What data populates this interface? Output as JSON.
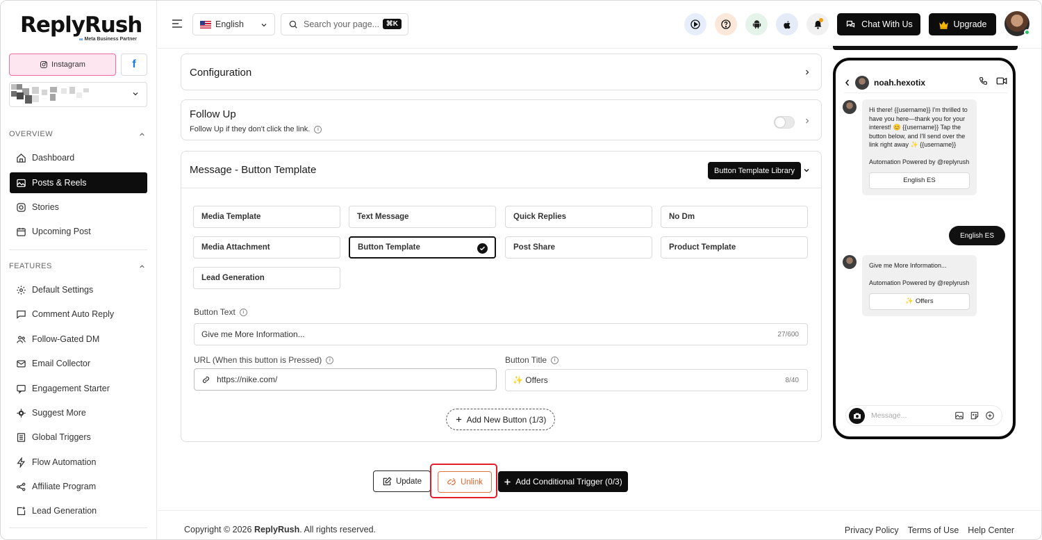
{
  "brand": {
    "name": "ReplyRush",
    "partner": "Meta Business Partner"
  },
  "accounts": {
    "instagram_label": "Instagram",
    "facebook_label": "f"
  },
  "sidebar": {
    "overview_label": "OVERVIEW",
    "features_label": "FEATURES",
    "overview_items": [
      {
        "label": "Dashboard",
        "icon": "home-icon"
      },
      {
        "label": "Posts & Reels",
        "icon": "image-icon",
        "active": true
      },
      {
        "label": "Stories",
        "icon": "instagram-icon"
      },
      {
        "label": "Upcoming Post",
        "icon": "calendar-icon"
      }
    ],
    "feature_items": [
      {
        "label": "Default Settings",
        "icon": "gear-icon"
      },
      {
        "label": "Comment Auto Reply",
        "icon": "comment-icon"
      },
      {
        "label": "Follow-Gated DM",
        "icon": "users-icon"
      },
      {
        "label": "Email Collector",
        "icon": "mail-icon"
      },
      {
        "label": "Engagement Starter",
        "icon": "chat-icon"
      },
      {
        "label": "Suggest More",
        "icon": "sparkle-gear-icon"
      },
      {
        "label": "Global Triggers",
        "icon": "list-icon"
      },
      {
        "label": "Flow Automation",
        "icon": "bolt-icon"
      },
      {
        "label": "Affiliate Program",
        "icon": "share-icon"
      },
      {
        "label": "Lead Generation",
        "icon": "plus-square-icon"
      }
    ]
  },
  "header": {
    "language": "English",
    "search_placeholder": "Search your page...",
    "shortcut": "⌘K",
    "chat_label": "Chat With Us",
    "upgrade_label": "Upgrade"
  },
  "main": {
    "configuration_title": "Configuration",
    "follow_up": {
      "title": "Follow Up",
      "subtitle": "Follow Up if they don't click the link."
    },
    "message_section": {
      "title": "Message - Button Template",
      "library_button": "Button Template Library",
      "options": [
        "Media Template",
        "Text Message",
        "Quick Replies",
        "No Dm",
        "Media Attachment",
        "Button Template",
        "Post Share",
        "Product Template",
        "Lead Generation"
      ],
      "selected_option": "Button Template",
      "button_text_label": "Button Text",
      "button_text_value": "Give me More Information...",
      "button_text_count": "27/600",
      "url_label": "URL (When this button is Pressed)",
      "url_value": "https://nike.com/",
      "button_title_label": "Button Title",
      "button_title_value": "✨ Offers",
      "button_title_count": "8/40",
      "add_button_label": "Add New Button (1/3)"
    },
    "actions": {
      "update": "Update",
      "unlink": "Unlink",
      "conditional": "Add Conditional Trigger (0/3)"
    }
  },
  "footer": {
    "copyright_prefix": "Copyright © 2026 ",
    "copyright_brand": "ReplyRush",
    "copyright_suffix": ". All rights reserved.",
    "links": [
      "Privacy Policy",
      "Terms of Use",
      "Help Center"
    ]
  },
  "preview": {
    "username": "noah.hexotix",
    "message1": "Hi there! {{username}} I'm thrilled to have you here—thank you for your interest! 😊 {{username}} Tap the button below, and I'll send over the link right away ✨ {{username}}",
    "powered1": "Automation Powered by @replyrush",
    "bubble_button1": "English ES",
    "outgoing": "English ES",
    "message2": "Give me More Information...",
    "powered2": "Automation Powered by @replyrush",
    "bubble_button2": "✨ Offers",
    "input_placeholder": "Message..."
  },
  "colors": {
    "accent": "#0d0d0d",
    "instagram_pink": "#f06ca1",
    "unlink_orange": "#e2652f",
    "highlight_red": "#e11d2a"
  }
}
